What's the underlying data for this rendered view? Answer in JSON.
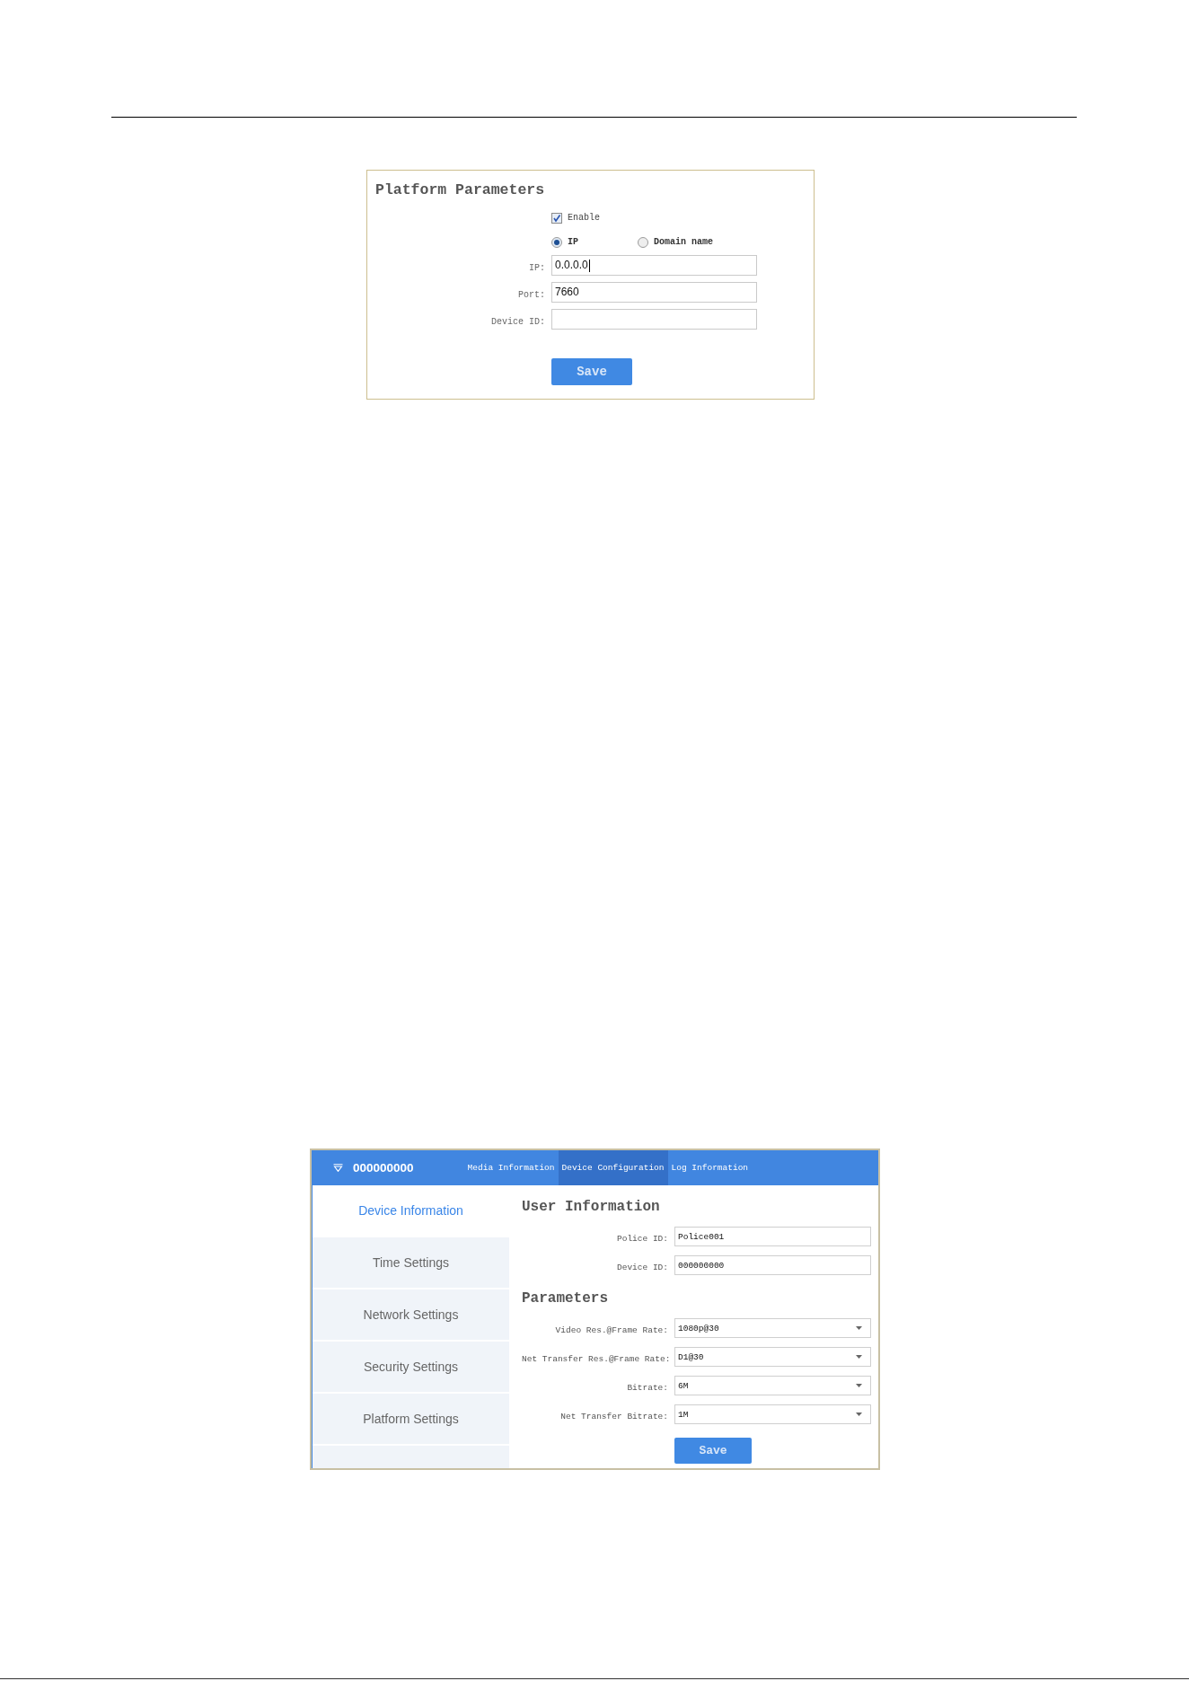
{
  "platform_panel": {
    "title": "Platform Parameters",
    "enable": {
      "label": "Enable",
      "checked": true
    },
    "address_type": [
      {
        "label": "IP",
        "selected": true
      },
      {
        "label": "Domain name",
        "selected": false
      }
    ],
    "fields": [
      {
        "label": "IP:",
        "value": "0.0.0.0",
        "focused": true
      },
      {
        "label": "Port:",
        "value": "7660",
        "focused": false
      },
      {
        "label": "Device ID:",
        "focused": false
      }
    ],
    "save_button": "Save"
  },
  "screenshot": {
    "header": {
      "device_name": "000000000",
      "nav": [
        {
          "label": "Media Information",
          "selected": false
        },
        {
          "label": "Device Configuration",
          "selected": true
        },
        {
          "label": "Log Information",
          "selected": false
        }
      ]
    },
    "sidebar": {
      "items": [
        {
          "label": "Device Information",
          "selected": true
        },
        {
          "label": "Time Settings",
          "selected": false
        },
        {
          "label": "Network Settings",
          "selected": false
        },
        {
          "label": "Security Settings",
          "selected": false
        },
        {
          "label": "Platform Settings",
          "selected": false
        },
        {
          "selected": false
        }
      ]
    },
    "sections": [
      {
        "title": "User Information",
        "fields": [
          {
            "label": "Police ID:",
            "value": "Police001",
            "kind": "text"
          },
          {
            "label": "Device ID:",
            "value": "000000000",
            "kind": "text"
          }
        ]
      },
      {
        "title": "Parameters",
        "fields": [
          {
            "label": "Video Res.@Frame Rate:",
            "value": "1080p@30",
            "kind": "select"
          },
          {
            "label": "Net Transfer Res.@Frame Rate:",
            "value": "D1@30",
            "kind": "select"
          },
          {
            "label": "Bitrate:",
            "value": "6M",
            "kind": "select"
          },
          {
            "label": "Net Transfer Bitrate:",
            "value": "1M",
            "kind": "select"
          }
        ]
      }
    ],
    "save_button": "Save"
  }
}
